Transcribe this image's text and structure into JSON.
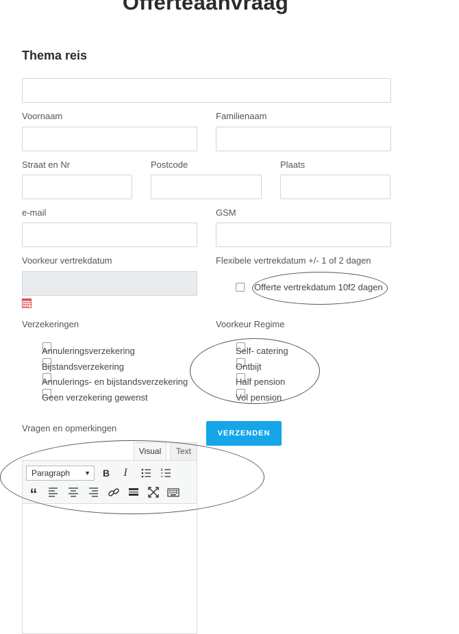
{
  "page_title": "Offerteaanvraag",
  "section_title": "Thema reis",
  "fields": {
    "thema_reis": {
      "value": "",
      "placeholder": ""
    },
    "voornaam": {
      "label": "Voornaam",
      "value": ""
    },
    "familienaam": {
      "label": "Familienaam",
      "value": ""
    },
    "straat": {
      "label": "Straat en Nr",
      "value": ""
    },
    "postcode": {
      "label": "Postcode",
      "value": ""
    },
    "plaats": {
      "label": "Plaats",
      "value": ""
    },
    "email": {
      "label": "e-mail",
      "value": ""
    },
    "gsm": {
      "label": "GSM",
      "value": ""
    },
    "vertrekdatum": {
      "label": "Voorkeur vertrekdatum",
      "value": ""
    },
    "flexibel": {
      "label": "Flexibele vertrekdatum +/- 1 of 2 dagen",
      "option": "Offerte vertrekdatum 10f2 dagen"
    }
  },
  "verzekeringen": {
    "label": "Verzekeringen",
    "options": [
      "Annuleringsverzekering",
      "Bijstandsverzekering",
      "Annulerings- en bijstandsverzekering",
      "Geen verzekering gewenst"
    ]
  },
  "regime": {
    "label": "Voorkeur Regime",
    "options": [
      "Self- catering",
      "Ontbijt",
      "Half pension",
      "Vol pension"
    ]
  },
  "vragen": {
    "label": "Vragen en opmerkingen",
    "tabs": [
      "Visual",
      "Text"
    ],
    "format_value": "Paragraph"
  },
  "submit_label": "VERZENDEN",
  "icons": {
    "calendar": "calendar-icon",
    "bold": "B",
    "italic": "I",
    "quote": "“"
  },
  "colors": {
    "accent": "#16a5e8",
    "calendar": "#e04a4a"
  }
}
